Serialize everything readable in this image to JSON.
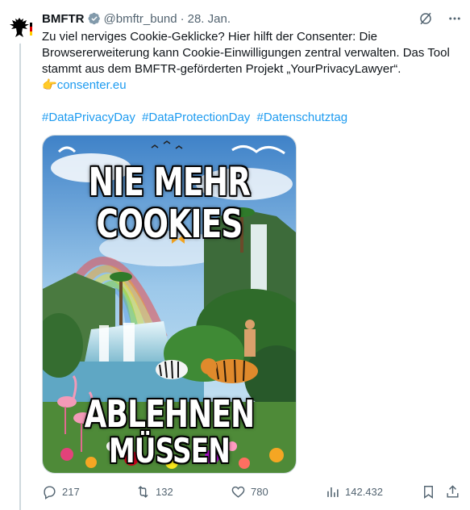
{
  "author": {
    "name": "BMFTR",
    "handle": "@bmftr_bund",
    "separator": "·",
    "date": "28. Jan."
  },
  "tweet": {
    "text_main": "Zu viel nerviges Cookie-Geklicke? Hier hilft der Consenter: Die Browsererweiterung kann Cookie-Einwilligungen zentral verwalten. Das Tool stammt aus dem BMFTR-geförderten Projekt „YourPrivacyLawyer“.",
    "pointer_emoji": "👉",
    "link_text": "consenter.eu",
    "hashtags": [
      "#DataPrivacyDay",
      "#DataProtectionDay",
      "#Datenschutztag"
    ]
  },
  "media": {
    "top_line_1": "NIE MEHR",
    "top_line_2": "COOKIES",
    "bottom_line_1": "ABLEHNEN",
    "bottom_line_2": "MÜSSEN"
  },
  "actions": {
    "replies": "217",
    "reposts": "132",
    "likes": "780",
    "views": "142.432"
  },
  "colors": {
    "accent": "#1d9bf0",
    "secondary_text": "#536471",
    "border": "#cfd9de"
  },
  "icons": {
    "verified": "verified-badge-icon",
    "grok": "grok-icon",
    "more": "more-dots-icon",
    "reply": "reply-icon",
    "repost": "repost-icon",
    "like": "heart-icon",
    "views": "views-chart-icon",
    "bookmark": "bookmark-icon",
    "share": "share-icon"
  }
}
